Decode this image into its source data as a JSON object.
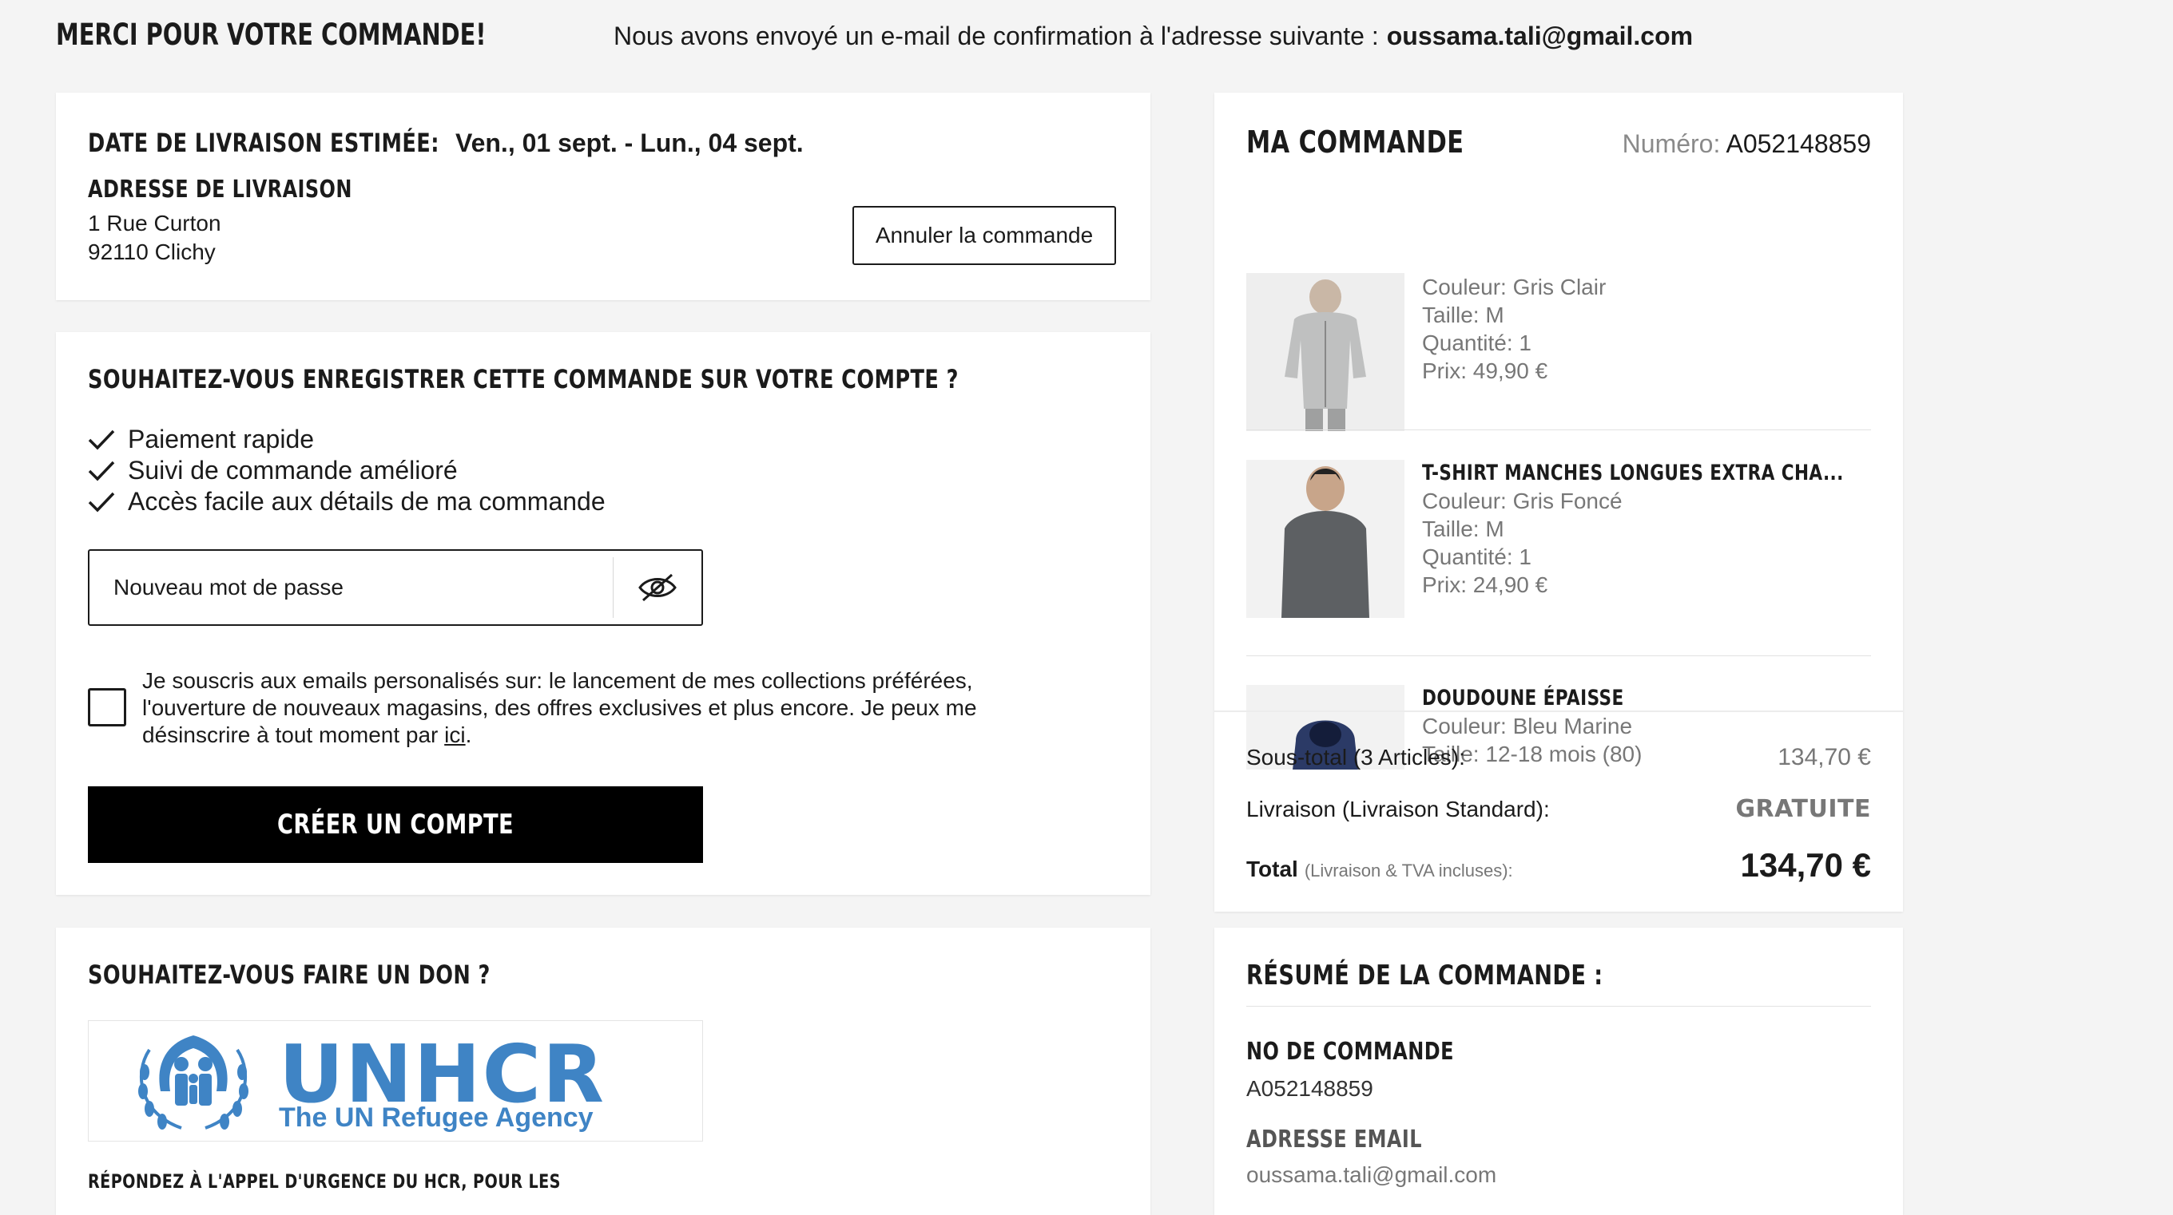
{
  "header": {
    "title": "MERCI POUR VOTRE COMMANDE!",
    "text": "Nous avons envoyé un e-mail de confirmation à l'adresse suivante :",
    "email": "oussama.tali@gmail.com"
  },
  "delivery": {
    "label": "DATE DE LIVRAISON ESTIMÉE:",
    "date": "Ven., 01 sept. - Lun., 04 sept.",
    "address_label": "ADRESSE DE LIVRAISON",
    "address_line1": "1 Rue Curton",
    "address_line2": "92110 Clichy",
    "cancel_label": "Annuler la commande"
  },
  "account": {
    "question": "SOUHAITEZ-VOUS ENREGISTRER CETTE COMMANDE SUR VOTRE COMPTE ?",
    "benefits": [
      "Paiement rapide",
      "Suivi de commande amélioré",
      "Accès facile aux détails de ma commande"
    ],
    "password_placeholder": "Nouveau mot de passe",
    "consent_text": "Je souscris aux emails personalisés sur: le lancement de mes collections préférées, l'ouverture de nouveaux magasins, des offres exclusives et plus encore. Je peux me désinscrire à tout moment par ",
    "consent_link": "ici",
    "consent_end": ".",
    "create_label": "CRÉER UN COMPTE"
  },
  "donation": {
    "question": "SOUHAITEZ-VOUS FAIRE UN DON ?",
    "logo_name": "UNHCR",
    "logo_sub": "The UN Refugee Agency",
    "appeal": "RÉPONDEZ À L'APPEL D'URGENCE DU HCR, POUR LES"
  },
  "order": {
    "title": "MA COMMANDE",
    "number_label": "Numéro:",
    "number": "A052148859",
    "items": [
      {
        "name": "",
        "color": "Couleur: Gris Clair",
        "size": "Taille: M",
        "qty": "Quantité: 1",
        "price": "Prix: 49,90 €"
      },
      {
        "name": "T-SHIRT MANCHES LONGUES EXTRA CHA...",
        "color": "Couleur: Gris Foncé",
        "size": "Taille: M",
        "qty": "Quantité: 1",
        "price": "Prix: 24,90 €"
      },
      {
        "name": "DOUDOUNE ÉPAISSE",
        "color": "Couleur: Bleu Marine",
        "size": "Taille: 12-18 mois (80)"
      }
    ],
    "subtotal_label": "Sous-total (3 Articles):",
    "subtotal": "134,70 €",
    "shipping_label": "Livraison (Livraison Standard):",
    "shipping": "GRATUITE",
    "total_label": "Total",
    "total_note": "(Livraison & TVA incluses):",
    "total": "134,70 €"
  },
  "summary": {
    "title": "RÉSUMÉ DE LA COMMANDE :",
    "order_no_label": "NO DE COMMANDE",
    "order_no": "A052148859",
    "email_label": "ADRESSE EMAIL",
    "email": "oussama.tali@gmail.com"
  },
  "colors": {
    "accent": "#000000",
    "unhcr_blue": "#3f84c5",
    "background": "#f4f4f4"
  }
}
